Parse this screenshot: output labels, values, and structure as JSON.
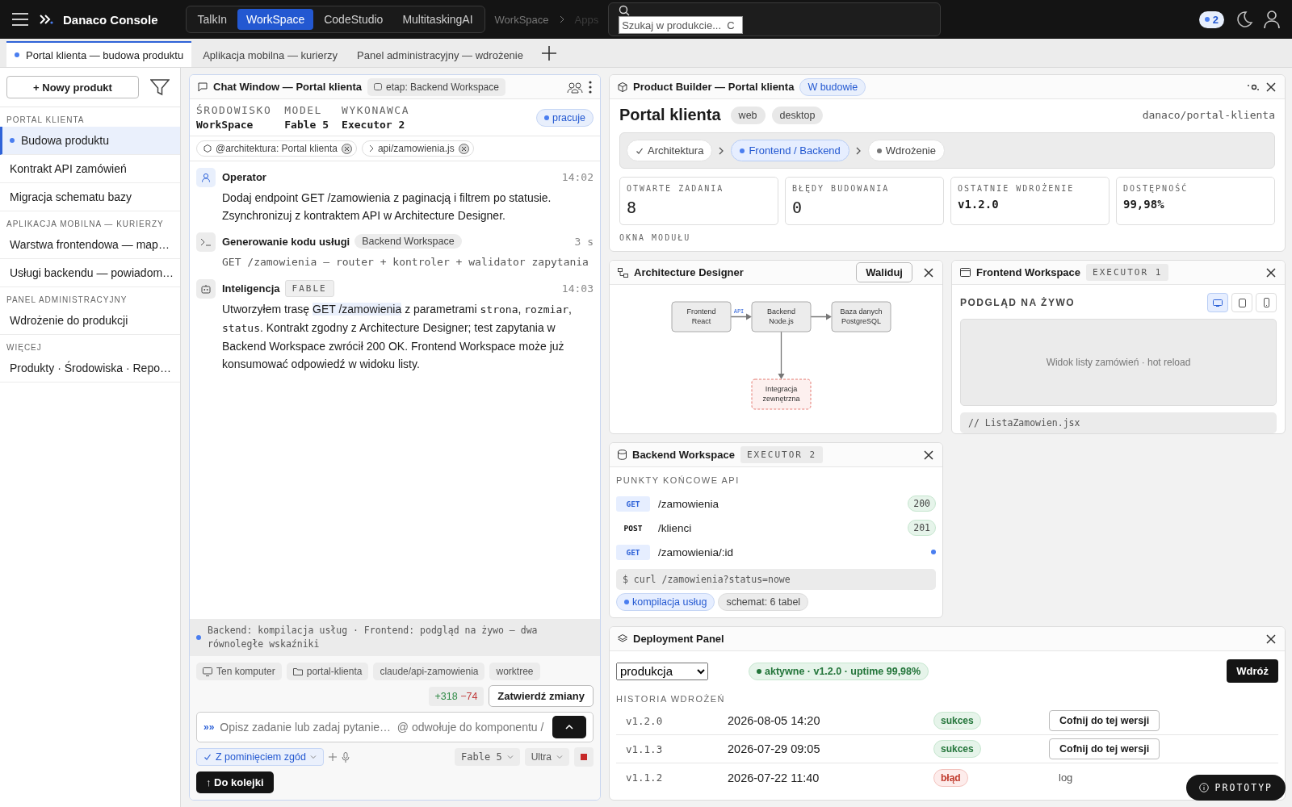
{
  "topbar": {
    "brand": "Danaco Console",
    "apps": [
      {
        "label": "TalkIn",
        "selected": false
      },
      {
        "label": "WorkSpace",
        "selected": true
      },
      {
        "label": "CodeStudio",
        "selected": false
      },
      {
        "label": "MultitaskingAI",
        "selected": false
      }
    ],
    "breadcrumb": [
      "WorkSpace",
      "Apps"
    ],
    "search": {
      "placeholder": "Szukaj w produkcie...  C"
    },
    "notifications": "2"
  },
  "tabs": [
    {
      "label": "Portal klienta — budowa produktu",
      "selected": true
    },
    {
      "label": "Aplikacja mobilna — kurierzy",
      "selected": false
    },
    {
      "label": "Panel administracyjny — wdrożenie",
      "selected": false
    }
  ],
  "sidebar": {
    "new_button": "+ Nowy produkt",
    "groups": [
      {
        "title": "PORTAL KLIENTA",
        "items": [
          {
            "label": "Budowa produktu",
            "selected": true
          },
          {
            "label": "Kontrakt API zamówień",
            "selected": false
          },
          {
            "label": "Migracja schematu bazy",
            "selected": false
          }
        ]
      },
      {
        "title": "APLIKACJA MOBILNA — KURIERZY",
        "items": [
          {
            "label": "Warstwa frontendowa — map…",
            "selected": false
          },
          {
            "label": "Usługi backendu — powiadom…",
            "selected": false
          }
        ]
      },
      {
        "title": "PANEL ADMINISTRACYJNY",
        "items": [
          {
            "label": "Wdrożenie do produkcji",
            "selected": false
          }
        ]
      },
      {
        "title": "WIĘCEJ",
        "items": [
          {
            "label": "Produkty · Środowiska · Repo…",
            "selected": false
          }
        ]
      }
    ]
  },
  "chat": {
    "title": "Chat Window — Portal klienta",
    "stage": "etap: Backend Workspace",
    "meta": [
      {
        "label": "ŚRODOWISKO",
        "value": "WorkSpace"
      },
      {
        "label": "MODEL",
        "value": "Fable 5"
      },
      {
        "label": "WYKONAWCA",
        "value": "Executor 2"
      }
    ],
    "status": "pracuje",
    "context": [
      {
        "kind": "component",
        "label": "@architektura: Portal klienta"
      },
      {
        "kind": "file",
        "label": "api/zamowienia.js"
      }
    ],
    "messages": [
      {
        "kind": "user",
        "author": "Operator",
        "time": "14:02",
        "segments": [
          {
            "kind": "plain",
            "text": "Dodaj endpoint GET /zamowienia z paginacją i filtrem po statusie. Zsynchronizuj z kontraktem API w Architecture Designer."
          }
        ]
      },
      {
        "kind": "tool",
        "author": "Generowanie kodu usługi",
        "tag": "Backend Workspace",
        "time": "3 s",
        "segments": [
          {
            "kind": "code",
            "text": "GET /zamowienia — router + kontroler + walidator zapytania"
          }
        ]
      },
      {
        "kind": "ai",
        "author": "Inteligencja",
        "tag": "FABLE",
        "time": "14:03",
        "segments": [
          {
            "kind": "plain",
            "text": "Utworzyłem trasę "
          },
          {
            "kind": "mention",
            "text": "GET /zamowienia"
          },
          {
            "kind": "plain",
            "text": " z parametrami "
          },
          {
            "kind": "code",
            "text": "strona"
          },
          {
            "kind": "plain",
            "text": ", "
          },
          {
            "kind": "code",
            "text": "rozmiar"
          },
          {
            "kind": "plain",
            "text": ", "
          },
          {
            "kind": "code",
            "text": "status"
          },
          {
            "kind": "plain",
            "text": ". Kontrakt zgodny z Architecture Designer; test zapytania w Backend Workspace zwrócił 200 OK. Frontend Workspace może już konsumować odpowiedź w widoku listy."
          }
        ]
      }
    ],
    "activity": "Backend: kompilacja usług · Frontend: podgląd na żywo — dwa równoległe wskaźniki",
    "env": [
      {
        "kind": "computer",
        "label": "Ten komputer"
      },
      {
        "kind": "folder",
        "label": "portal-klienta"
      },
      {
        "kind": "plain",
        "label": "claude/api-zamowienia"
      },
      {
        "kind": "plain",
        "label": "worktree"
      }
    ],
    "diff": {
      "added": "+318",
      "removed": "−74"
    },
    "commit": "Zatwierdź zmiany",
    "composer": {
      "prompt": "»»",
      "placeholder": "Opisz zadanie lub zadaj pytanie…  @ odwołuje do komponentu /",
      "permission": {
        "label": "Z pominięciem zgód",
        "checked": true
      },
      "model": "Fable 5",
      "effort": "Ultra",
      "queue": "↑ Do kolejki"
    }
  },
  "product": {
    "title": "Product Builder — Portal klienta",
    "status": "W budowie",
    "name": "Portal klienta",
    "platforms": [
      "web",
      "desktop"
    ],
    "repo": "danaco/portal-klienta",
    "stages": [
      {
        "label": "Architektura",
        "completed": true,
        "selected": false
      },
      {
        "label": "Frontend / Backend",
        "completed": false,
        "selected": true
      },
      {
        "label": "Wdrożenie",
        "completed": false,
        "selected": false
      }
    ],
    "stats": [
      {
        "label": "OTWARTE ZADANIA",
        "value": "8",
        "kind": "count"
      },
      {
        "label": "BŁĘDY BUDOWANIA",
        "value": "0",
        "kind": "count"
      },
      {
        "label": "OSTATNIE WDROŻENIE",
        "value": "v1.2.0",
        "kind": "text"
      },
      {
        "label": "DOSTĘPNOŚĆ",
        "value": "99,98%",
        "kind": "text"
      }
    ],
    "section": "OKNA MODUŁU"
  },
  "architecture": {
    "title": "Architecture Designer",
    "button": "Waliduj",
    "nodes": [
      {
        "lines": [
          "Frontend",
          "React"
        ],
        "kind": "service"
      },
      {
        "lines": [
          "Backend",
          "Node.js"
        ],
        "kind": "service"
      },
      {
        "lines": [
          "Baza danych",
          "PostgreSQL"
        ],
        "kind": "service"
      },
      {
        "lines": [
          "Integracja",
          "zewnętrzna"
        ],
        "kind": "external"
      }
    ],
    "edge_label": "API"
  },
  "frontend": {
    "title": "Frontend Workspace",
    "tag": "EXECUTOR 1",
    "section": "PODGLĄD NA ŻYWO",
    "devices": [
      {
        "kind": "desktop",
        "selected": true
      },
      {
        "kind": "tablet",
        "selected": false
      },
      {
        "kind": "phone",
        "selected": false
      }
    ],
    "preview": "Widok listy zamówień · hot reload",
    "code": "// ListaZamowien.jsx"
  },
  "backend": {
    "title": "Backend Workspace",
    "tag": "EXECUTOR 2",
    "section": "PUNKTY KOŃCOWE API",
    "endpoints": [
      {
        "method": "GET",
        "kind": "get",
        "path": "/zamowienia",
        "status": "200",
        "pending": false
      },
      {
        "method": "POST",
        "kind": "post",
        "path": "/klienci",
        "status": "201",
        "pending": false
      },
      {
        "method": "GET",
        "kind": "get",
        "path": "/zamowienia/:id",
        "pending": true
      }
    ],
    "terminal": "$ curl /zamowienia?status=nowe",
    "chips": [
      {
        "label": "kompilacja usług",
        "active": true
      },
      {
        "label": "schemat: 6 tabel",
        "active": false
      }
    ]
  },
  "deploy": {
    "title": "Deployment Panel",
    "environment": "produkcja",
    "status": "aktywne · v1.2.0 · uptime 99,98%",
    "button": "Wdróż",
    "section": "HISTORIA WDROŻEŃ",
    "rows": [
      {
        "version": "v1.2.0",
        "date": "2026-08-05 14:20",
        "result": "sukces",
        "kind": "success",
        "action": {
          "label": "Cofnij do tej wersji",
          "kind": "button"
        }
      },
      {
        "version": "v1.1.3",
        "date": "2026-07-29 09:05",
        "result": "sukces",
        "kind": "success",
        "action": {
          "label": "Cofnij do tej wersji",
          "kind": "button"
        }
      },
      {
        "version": "v1.1.2",
        "date": "2026-07-22 11:40",
        "result": "błąd",
        "kind": "error",
        "action": {
          "label": "log",
          "kind": "link"
        }
      }
    ]
  },
  "badge": "PROTOTYP"
}
